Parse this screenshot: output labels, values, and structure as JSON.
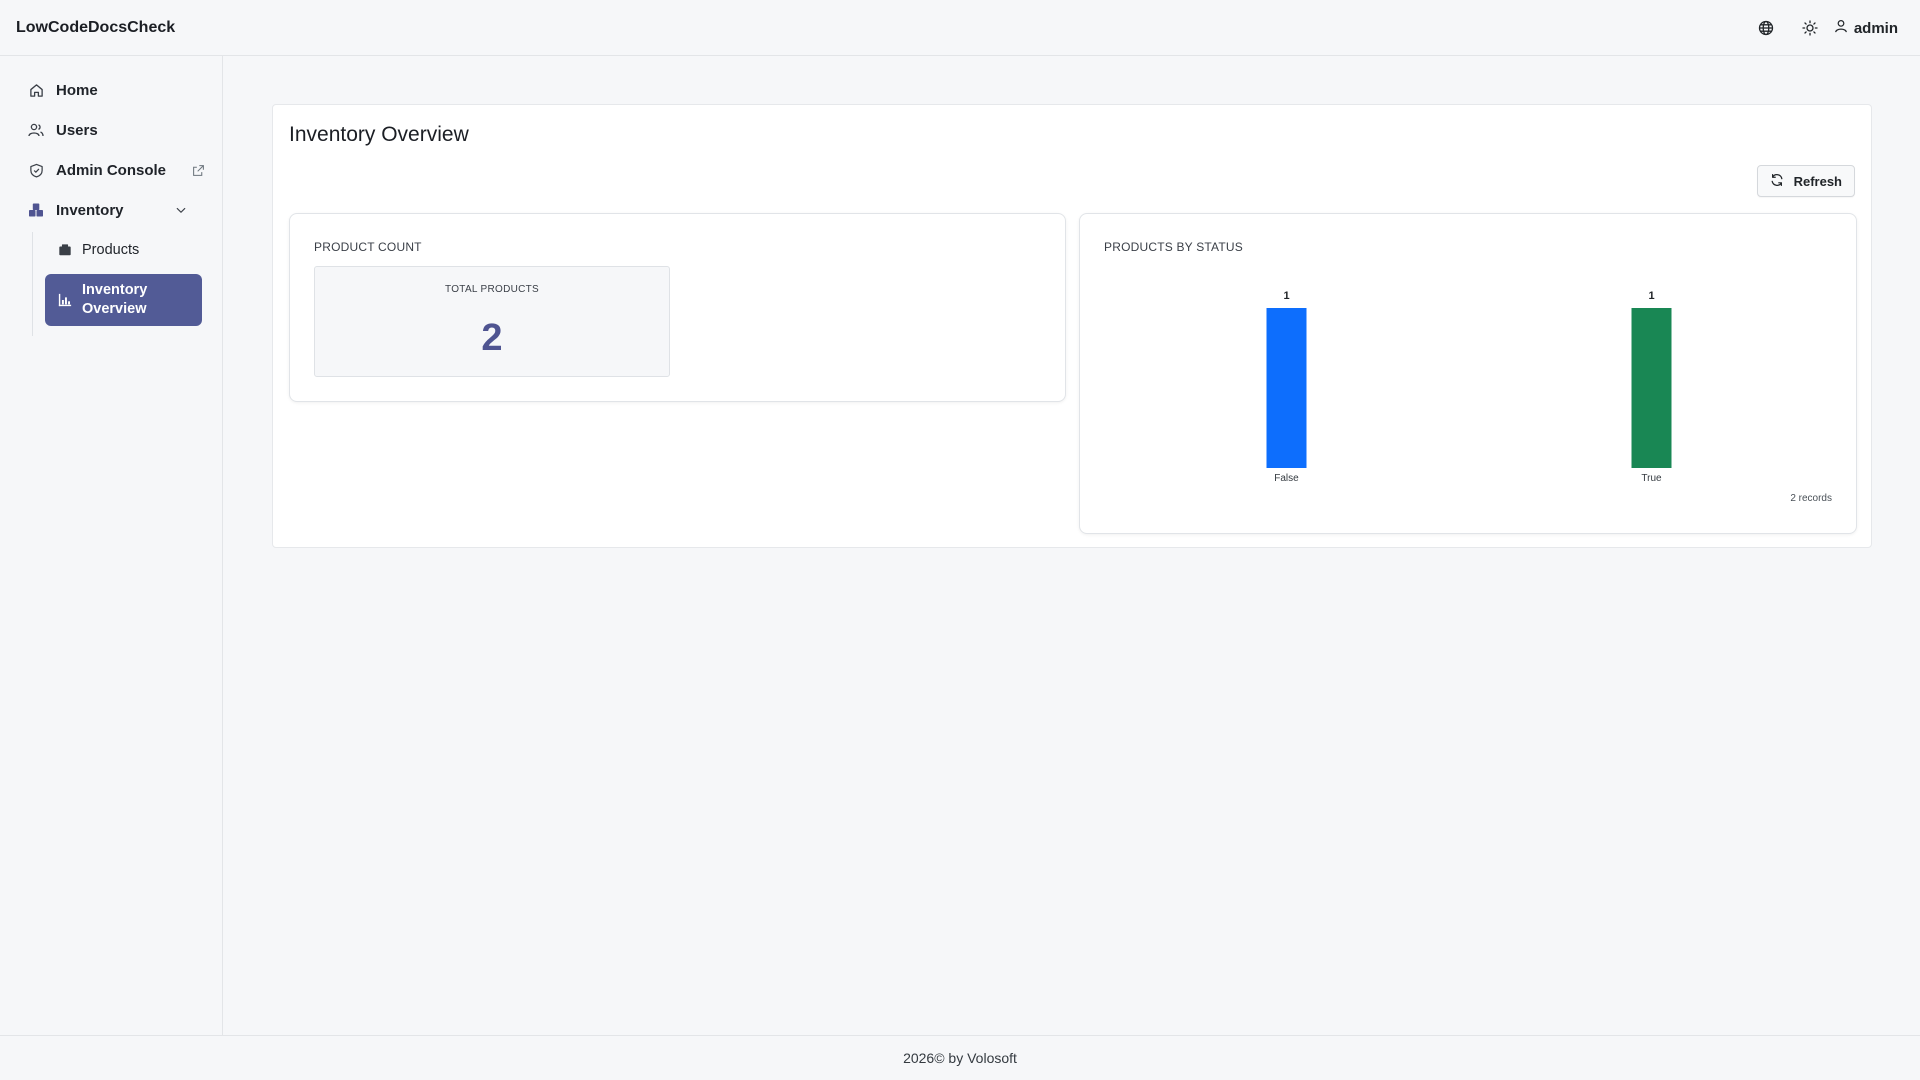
{
  "app": {
    "brand": "LowCodeDocsCheck"
  },
  "header": {
    "user_label": "admin"
  },
  "sidebar": {
    "items": [
      {
        "label": "Home",
        "icon": "home-icon"
      },
      {
        "label": "Users",
        "icon": "users-icon"
      },
      {
        "label": "Admin Console",
        "icon": "shield-icon",
        "external": true
      },
      {
        "label": "Inventory",
        "icon": "inventory-icon",
        "expanded": true
      }
    ],
    "subitems": [
      {
        "label": "Products",
        "icon": "box-icon"
      },
      {
        "label_line1": "Inventory",
        "label_line2": "Overview",
        "icon": "chart-icon",
        "active": true
      }
    ]
  },
  "page": {
    "title": "Inventory Overview",
    "refresh_label": "Refresh"
  },
  "widgets": {
    "count": {
      "title": "PRODUCT COUNT",
      "stat_label": "TOTAL PRODUCTS",
      "stat_value": "2"
    },
    "status": {
      "title": "PRODUCTS BY STATUS",
      "records": "2 records"
    }
  },
  "chart_data": {
    "type": "bar",
    "title": "PRODUCTS BY STATUS",
    "categories": [
      "False",
      "True"
    ],
    "values": [
      1,
      1
    ],
    "colors": [
      "#0d6efd",
      "#198754"
    ],
    "xlabel": "",
    "ylabel": "",
    "ylim": [
      0,
      1
    ],
    "grid": false
  },
  "colors": {
    "accent": "#525b96",
    "stat_value": "#4f5491"
  },
  "footer": {
    "text": "2026© by Volosoft"
  }
}
